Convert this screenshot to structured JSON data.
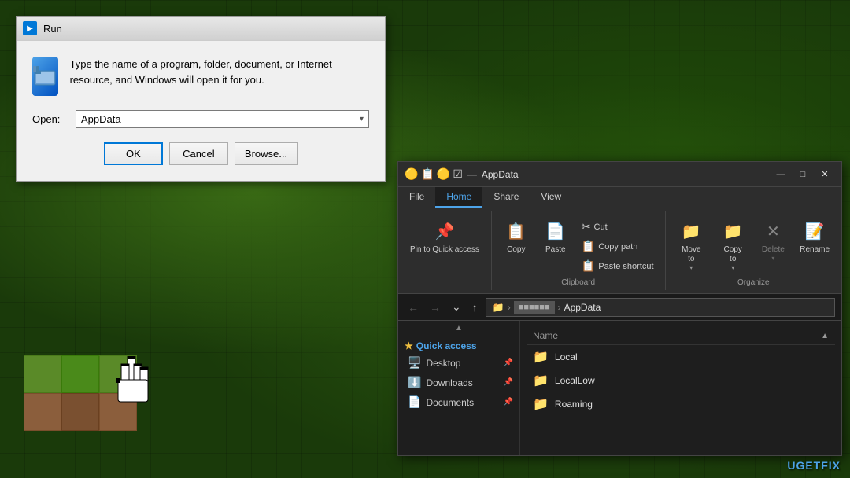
{
  "background": {
    "color": "#1a3a0a"
  },
  "run_dialog": {
    "title": "Run",
    "description": "Type the name of a program, folder, document, or Internet resource, and Windows will open it for you.",
    "open_label": "Open:",
    "input_value": "AppData",
    "dropdown_placeholder": "AppData",
    "ok_label": "OK",
    "cancel_label": "Cancel",
    "browse_label": "Browse..."
  },
  "explorer": {
    "title": "AppData",
    "titlebar_icons": [
      "🟡",
      "📋",
      "🟡",
      "☑"
    ],
    "tabs": [
      {
        "label": "File",
        "active": false
      },
      {
        "label": "Home",
        "active": true
      },
      {
        "label": "Share",
        "active": false
      },
      {
        "label": "View",
        "active": false
      }
    ],
    "ribbon": {
      "clipboard_group": {
        "label": "Clipboard",
        "pin_btn": "Pin to Quick access",
        "copy_btn": "Copy",
        "paste_btn": "Paste",
        "cut_btn": "Cut",
        "copy_path_btn": "Copy path",
        "paste_shortcut_btn": "Paste shortcut"
      },
      "organize_group": {
        "label": "Organize",
        "move_to_btn": "Move to",
        "copy_to_btn": "Copy to",
        "delete_btn": "Delete",
        "rename_btn": "Rename"
      }
    },
    "address_bar": {
      "path_segments": [
        "AppData"
      ],
      "breadcrumb_folder": "AppData"
    },
    "sidebar": {
      "quick_access_label": "Quick access",
      "items": [
        {
          "label": "Desktop",
          "icon": "🖥️",
          "pinned": true
        },
        {
          "label": "Downloads",
          "icon": "⬇️",
          "pinned": true
        },
        {
          "label": "Documents",
          "icon": "📄",
          "pinned": true
        }
      ]
    },
    "file_list": {
      "header": "Name",
      "items": [
        {
          "name": "Local",
          "icon": "🟡"
        },
        {
          "name": "LocalLow",
          "icon": "🟡"
        },
        {
          "name": "Roaming",
          "icon": "🟡"
        }
      ]
    }
  },
  "watermark": {
    "text": "UGETFIX"
  }
}
